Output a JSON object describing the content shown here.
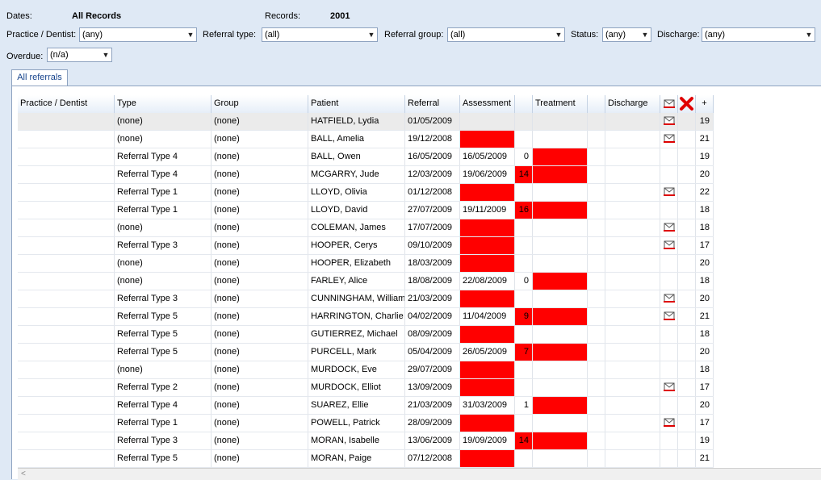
{
  "header": {
    "dates_label": "Dates:",
    "dates_value": "All Records",
    "records_label": "Records:",
    "records_value": "2001"
  },
  "filters": {
    "practice_label": "Practice / Dentist:",
    "practice_value": "(any)",
    "referral_type_label": "Referral type:",
    "referral_type_value": "(all)",
    "referral_group_label": "Referral group:",
    "referral_group_value": "(all)",
    "status_label": "Status:",
    "status_value": "(any)",
    "discharge_label": "Discharge:",
    "discharge_value": "(any)",
    "overdue_label": "Overdue:",
    "overdue_value": "(n/a)"
  },
  "tabs": [
    {
      "label": "All referrals"
    }
  ],
  "columns": {
    "practice": "Practice / Dentist",
    "type": "Type",
    "group": "Group",
    "patient": "Patient",
    "referral": "Referral",
    "assessment": "Assessment",
    "treatment": "Treatment",
    "discharge": "Discharge",
    "plus": "+"
  },
  "colors": {
    "overdue": "#ff0000",
    "selected_row": "#ebebeb",
    "header_accent": "#15428b"
  },
  "icons": {
    "letter": "letter-icon",
    "delete": "delete-icon"
  },
  "rows": [
    {
      "type": "(none)",
      "group": "(none)",
      "patient": "HATFIELD, Lydia",
      "referral": "01/05/2009",
      "assessment": "",
      "assess_red": false,
      "days": "",
      "days_red": false,
      "treat_red": false,
      "letter": true,
      "count": "19"
    },
    {
      "type": "(none)",
      "group": "(none)",
      "patient": "BALL, Amelia",
      "referral": "19/12/2008",
      "assessment": "",
      "assess_red": true,
      "days": "",
      "days_red": false,
      "treat_red": false,
      "letter": true,
      "count": "21"
    },
    {
      "type": "Referral Type 4",
      "group": "(none)",
      "patient": "BALL, Owen",
      "referral": "16/05/2009",
      "assessment": "16/05/2009",
      "assess_red": false,
      "days": "0",
      "days_red": false,
      "treat_red": true,
      "letter": false,
      "count": "19"
    },
    {
      "type": "Referral Type 4",
      "group": "(none)",
      "patient": "MCGARRY, Jude",
      "referral": "12/03/2009",
      "assessment": "19/06/2009",
      "assess_red": false,
      "days": "14",
      "days_red": true,
      "treat_red": true,
      "letter": false,
      "count": "20"
    },
    {
      "type": "Referral Type 1",
      "group": "(none)",
      "patient": "LLOYD, Olivia",
      "referral": "01/12/2008",
      "assessment": "",
      "assess_red": true,
      "days": "",
      "days_red": false,
      "treat_red": false,
      "letter": true,
      "count": "22"
    },
    {
      "type": "Referral Type 1",
      "group": "(none)",
      "patient": "LLOYD, David",
      "referral": "27/07/2009",
      "assessment": "19/11/2009",
      "assess_red": false,
      "days": "16",
      "days_red": true,
      "treat_red": true,
      "letter": false,
      "count": "18"
    },
    {
      "type": "(none)",
      "group": "(none)",
      "patient": "COLEMAN, James",
      "referral": "17/07/2009",
      "assessment": "",
      "assess_red": true,
      "days": "",
      "days_red": false,
      "treat_red": false,
      "letter": true,
      "count": "18"
    },
    {
      "type": "Referral Type 3",
      "group": "(none)",
      "patient": "HOOPER, Cerys",
      "referral": "09/10/2009",
      "assessment": "",
      "assess_red": true,
      "days": "",
      "days_red": false,
      "treat_red": false,
      "letter": true,
      "count": "17"
    },
    {
      "type": "(none)",
      "group": "(none)",
      "patient": "HOOPER, Elizabeth",
      "referral": "18/03/2009",
      "assessment": "",
      "assess_red": true,
      "days": "",
      "days_red": false,
      "treat_red": false,
      "letter": false,
      "count": "20"
    },
    {
      "type": "(none)",
      "group": "(none)",
      "patient": "FARLEY, Alice",
      "referral": "18/08/2009",
      "assessment": "22/08/2009",
      "assess_red": false,
      "days": "0",
      "days_red": false,
      "treat_red": true,
      "letter": false,
      "count": "18"
    },
    {
      "type": "Referral Type 3",
      "group": "(none)",
      "patient": "CUNNINGHAM, William",
      "referral": "21/03/2009",
      "assessment": "",
      "assess_red": true,
      "days": "",
      "days_red": false,
      "treat_red": false,
      "letter": true,
      "count": "20"
    },
    {
      "type": "Referral Type 5",
      "group": "(none)",
      "patient": "HARRINGTON, Charlie",
      "referral": "04/02/2009",
      "assessment": "11/04/2009",
      "assess_red": false,
      "days": "9",
      "days_red": true,
      "treat_red": true,
      "letter": true,
      "count": "21"
    },
    {
      "type": "Referral Type 5",
      "group": "(none)",
      "patient": "GUTIERREZ, Michael",
      "referral": "08/09/2009",
      "assessment": "",
      "assess_red": true,
      "days": "",
      "days_red": false,
      "treat_red": false,
      "letter": false,
      "count": "18"
    },
    {
      "type": "Referral Type 5",
      "group": "(none)",
      "patient": "PURCELL, Mark",
      "referral": "05/04/2009",
      "assessment": "26/05/2009",
      "assess_red": false,
      "days": "7",
      "days_red": true,
      "treat_red": true,
      "letter": false,
      "count": "20"
    },
    {
      "type": "(none)",
      "group": "(none)",
      "patient": "MURDOCK, Eve",
      "referral": "29/07/2009",
      "assessment": "",
      "assess_red": true,
      "days": "",
      "days_red": false,
      "treat_red": false,
      "letter": false,
      "count": "18"
    },
    {
      "type": "Referral Type 2",
      "group": "(none)",
      "patient": "MURDOCK, Elliot",
      "referral": "13/09/2009",
      "assessment": "",
      "assess_red": true,
      "days": "",
      "days_red": false,
      "treat_red": false,
      "letter": true,
      "count": "17"
    },
    {
      "type": "Referral Type 4",
      "group": "(none)",
      "patient": "SUAREZ, Ellie",
      "referral": "21/03/2009",
      "assessment": "31/03/2009",
      "assess_red": false,
      "days": "1",
      "days_red": false,
      "treat_red": true,
      "letter": false,
      "count": "20"
    },
    {
      "type": "Referral Type 1",
      "group": "(none)",
      "patient": "POWELL, Patrick",
      "referral": "28/09/2009",
      "assessment": "",
      "assess_red": true,
      "days": "",
      "days_red": false,
      "treat_red": false,
      "letter": true,
      "count": "17"
    },
    {
      "type": "Referral Type 3",
      "group": "(none)",
      "patient": "MORAN, Isabelle",
      "referral": "13/06/2009",
      "assessment": "19/09/2009",
      "assess_red": false,
      "days": "14",
      "days_red": true,
      "treat_red": true,
      "letter": false,
      "count": "19"
    },
    {
      "type": "Referral Type 5",
      "group": "(none)",
      "patient": "MORAN, Paige",
      "referral": "07/12/2008",
      "assessment": "",
      "assess_red": true,
      "days": "",
      "days_red": false,
      "treat_red": false,
      "letter": false,
      "count": "21"
    }
  ]
}
